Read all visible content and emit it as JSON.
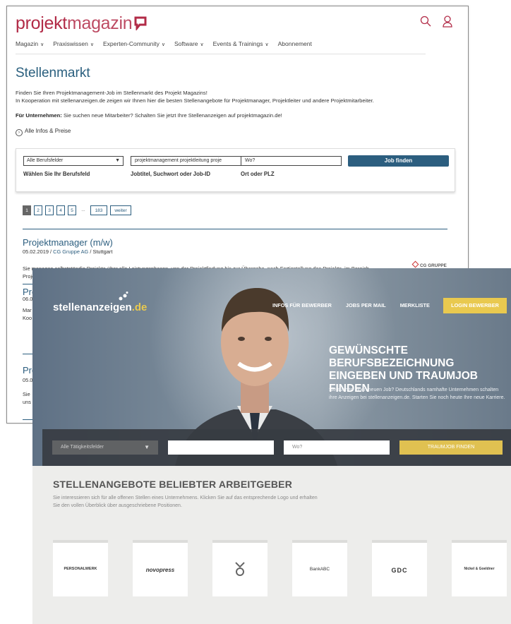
{
  "pm": {
    "logo_bold": "projekt",
    "logo_light": "magazin",
    "nav": [
      "Magazin",
      "Praxiswissen",
      "Experten-Community",
      "Software",
      "Events & Trainings",
      "Abonnement"
    ],
    "title": "Stellenmarkt",
    "intro_line1": "Finden Sie Ihren Projektmanagement-Job im Stellenmarkt des Projekt Magazins!",
    "intro_line2": "In Kooperation mit stellenanzeigen.de zeigen wir Ihnen hier die besten Stellenangebote für Projektmanager, Projektleiter und andere Projektmitarbeiter.",
    "firm_bold": "Für Unternehmen:",
    "firm_text": " Sie suchen neue Mitarbeiter? Schalten Sie jetzt Ihre Stellenanzeigen auf projektmagazin.de!",
    "all_info": "Alle Infos & Preise",
    "search": {
      "field_select": "Alle Berufsfelder",
      "field_label": "Wählen Sie Ihr Berufsfeld",
      "keyword_value": "projektmanagement projektleitung proje",
      "keyword_label": "Jobtitel, Suchwort oder Job-ID",
      "location_placeholder": "Wo?",
      "location_label": "Ort oder PLZ",
      "button": "Job finden"
    },
    "pager": [
      "1",
      "2",
      "3",
      "4",
      "5",
      "...",
      "183",
      "weiter"
    ],
    "jobs": [
      {
        "title": "Projektmanager (m/w)",
        "date": "05.02.2019 / ",
        "company": "CG Gruppe AG",
        "city": " / Stuttgart",
        "desc": "Sie managen selbstständig Projekte über alle Leistungsphasen, von der Projektfindung bis zur Übergabe, nach Fertigstellung des Projekts, im Bereich Projektentwicklung / Projektmanagement;...",
        "logo": "CG GRUPPE"
      },
      {
        "title": "Pro",
        "meta": "06.0",
        "desc1": "Mar",
        "desc2": "Koo"
      },
      {
        "title": "Pro",
        "meta": "05.0",
        "desc1": "Sie ",
        "desc2": "uns"
      }
    ]
  },
  "sa": {
    "brand": "stellenanzeigen",
    "brand_tld": ".de",
    "nav": [
      "INFOS FÜR BEWERBER",
      "JOBS PER MAIL",
      "MERKLISTE"
    ],
    "login": "LOGIN BEWERBER",
    "headline": "GEWÜNSCHTE BERUFSBEZEICHNUNG EINGEBEN UND TRAUMJOB FINDEN",
    "sub": "Sie suchen einen neuen Job? Deutschlands namhafte Unternehmen schalten ihre Anzeigen bei stellenanzeigen.de. Starten Sie noch heute Ihre neue Karriere.",
    "search": {
      "field_select": "Alle Tätigkeitsfelder",
      "keyword_value": "",
      "location_placeholder": "Wo?",
      "button": "TRAUMJOB FINDEN"
    },
    "section_title": "STELLENANGEBOTE BELIEBTER ARBEITGEBER",
    "section_desc": "Sie interessieren sich für alle offenen Stellen eines Unternehmens. Klicken Sie auf das entsprechende Logo und erhalten Sie den vollen Überblick über ausgeschriebene Positionen.",
    "employers": [
      "PERSONALWERK",
      "novopress",
      "",
      "BankABC",
      "GDC",
      "Nickel & Goeldner"
    ]
  },
  "colors": {
    "pm_accent": "#b22b47",
    "pm_blue": "#2c5e7f",
    "sa_gold": "#e9c94f"
  }
}
